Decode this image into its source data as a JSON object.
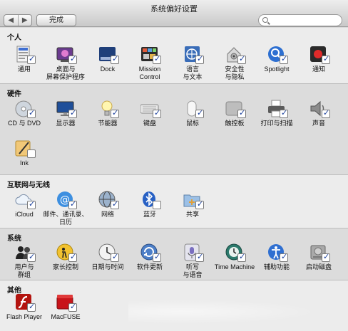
{
  "window": {
    "title": "系统偏好设置"
  },
  "toolbar": {
    "back": "◀",
    "forward": "▶",
    "done_label": "完成",
    "search_placeholder": ""
  },
  "sections": [
    {
      "title": "个人",
      "items": [
        {
          "label": "通用",
          "icon": "general-icon",
          "checked": true
        },
        {
          "label": "桌面与\n屏幕保护程序",
          "icon": "desktop-icon",
          "checked": true
        },
        {
          "label": "Dock",
          "icon": "dock-icon",
          "checked": true
        },
        {
          "label": "Mission\nControl",
          "icon": "mission-control-icon",
          "checked": true
        },
        {
          "label": "语言\n与文本",
          "icon": "language-icon",
          "checked": true
        },
        {
          "label": "安全性\n与隐私",
          "icon": "security-icon",
          "checked": true
        },
        {
          "label": "Spotlight",
          "icon": "spotlight-icon",
          "checked": true
        },
        {
          "label": "通知",
          "icon": "notifications-icon",
          "checked": true
        }
      ]
    },
    {
      "title": "硬件",
      "items": [
        {
          "label": "CD 与 DVD",
          "icon": "cd-dvd-icon",
          "checked": true
        },
        {
          "label": "显示器",
          "icon": "display-icon",
          "checked": true
        },
        {
          "label": "节能器",
          "icon": "energy-saver-icon",
          "checked": true
        },
        {
          "label": "键盘",
          "icon": "keyboard-icon",
          "checked": true
        },
        {
          "label": "鼠标",
          "icon": "mouse-icon",
          "checked": true
        },
        {
          "label": "触控板",
          "icon": "trackpad-icon",
          "checked": true
        },
        {
          "label": "打印与扫描",
          "icon": "printer-icon",
          "checked": true
        },
        {
          "label": "声音",
          "icon": "sound-icon",
          "checked": true
        },
        {
          "label": "Ink",
          "icon": "ink-icon",
          "checked": false
        }
      ]
    },
    {
      "title": "互联网与无线",
      "items": [
        {
          "label": "iCloud",
          "icon": "icloud-icon",
          "checked": true
        },
        {
          "label": "邮件、通讯录、\n日历",
          "icon": "mail-contacts-icon",
          "checked": true
        },
        {
          "label": "网络",
          "icon": "network-icon",
          "checked": true
        },
        {
          "label": "蓝牙",
          "icon": "bluetooth-icon",
          "checked": false
        },
        {
          "label": "共享",
          "icon": "sharing-icon",
          "checked": true
        }
      ]
    },
    {
      "title": "系统",
      "items": [
        {
          "label": "用户与\n群组",
          "icon": "users-icon",
          "checked": true
        },
        {
          "label": "家长控制",
          "icon": "parental-controls-icon",
          "checked": true
        },
        {
          "label": "日期与时间",
          "icon": "date-time-icon",
          "checked": true
        },
        {
          "label": "软件更新",
          "icon": "software-update-icon",
          "checked": true
        },
        {
          "label": "听写\n与语音",
          "icon": "dictation-icon",
          "checked": true
        },
        {
          "label": "Time Machine",
          "icon": "time-machine-icon",
          "checked": true
        },
        {
          "label": "辅助功能",
          "icon": "accessibility-icon",
          "checked": true
        },
        {
          "label": "启动磁盘",
          "icon": "startup-disk-icon",
          "checked": true
        }
      ]
    },
    {
      "title": "其他",
      "items": [
        {
          "label": "Flash Player",
          "icon": "flash-player-icon",
          "checked": true
        },
        {
          "label": "MacFUSE",
          "icon": "macfuse-icon",
          "checked": true
        }
      ]
    }
  ]
}
